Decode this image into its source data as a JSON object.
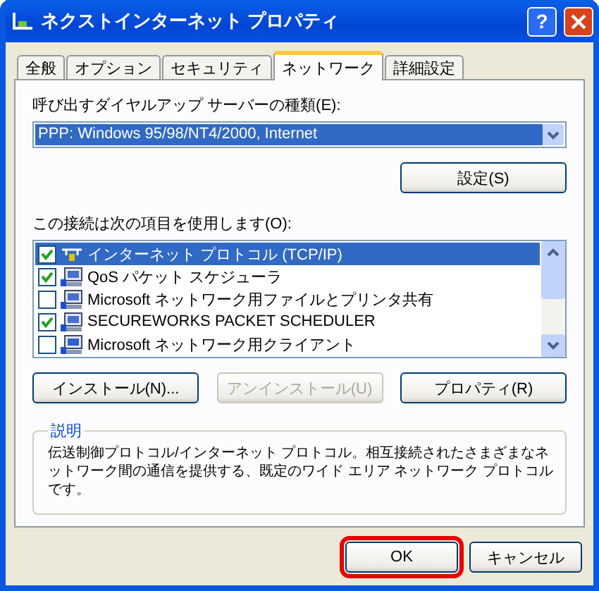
{
  "window": {
    "title": "ネクストインターネット プロパティ",
    "help": "?"
  },
  "tabs": [
    {
      "label": "全般",
      "selected": false
    },
    {
      "label": "オプション",
      "selected": false
    },
    {
      "label": "セキュリティ",
      "selected": false
    },
    {
      "label": "ネットワーク",
      "selected": true
    },
    {
      "label": "詳細設定",
      "selected": false
    }
  ],
  "server_type": {
    "label": "呼び出すダイヤルアップ サーバーの種類(E):",
    "value": "PPP: Windows 95/98/NT4/2000, Internet"
  },
  "settings_button": "設定(S)",
  "components": {
    "label": "この接続は次の項目を使用します(O):",
    "items": [
      {
        "kind": "protocol",
        "name": "インターネット プロトコル (TCP/IP)",
        "checked": true,
        "selected": true
      },
      {
        "kind": "service",
        "name": "QoS パケット スケジューラ",
        "checked": true,
        "selected": false
      },
      {
        "kind": "service",
        "name": "Microsoft ネットワーク用ファイルとプリンタ共有",
        "checked": false,
        "selected": false
      },
      {
        "kind": "service",
        "name": "SECUREWORKS PACKET SCHEDULER",
        "checked": true,
        "selected": false
      },
      {
        "kind": "client",
        "name": "Microsoft ネットワーク用クライアント",
        "checked": false,
        "selected": false
      }
    ]
  },
  "component_buttons": [
    {
      "label": "インストール(N)...",
      "disabled": false
    },
    {
      "label": "アンインストール(U)",
      "disabled": true
    },
    {
      "label": "プロパティ(R)",
      "disabled": false
    }
  ],
  "description": {
    "title": "説明",
    "text": "伝送制御プロトコル/インターネット プロトコル。相互接続されたさまざまなネットワーク間の通信を提供する、既定のワイド エリア ネットワーク プロトコルです。"
  },
  "dialog_buttons": [
    {
      "label": "OK",
      "highlighted": true
    },
    {
      "label": "キャンセル",
      "highlighted": false
    }
  ]
}
